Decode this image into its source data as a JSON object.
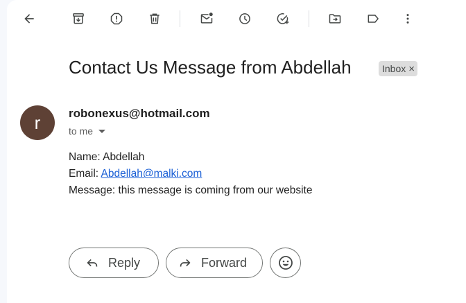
{
  "toolbar": {
    "icons": [
      "back-arrow-icon",
      "archive-icon",
      "report-spam-icon",
      "delete-icon",
      "mark-unread-icon",
      "snooze-icon",
      "add-to-tasks-icon",
      "move-to-icon",
      "label-icon",
      "more-options-icon"
    ]
  },
  "email": {
    "subject": "Contact Us Message from Abdellah",
    "label_chip": "Inbox",
    "chip_remove": "×",
    "avatar_letter": "r",
    "avatar_color": "#5e4135",
    "sender": "robonexus@hotmail.com",
    "recipient": "to me",
    "body": {
      "name_line": "Name: Abdellah",
      "email_label": "Email: ",
      "email_link": "Abdellah@malki.com",
      "message_line": "Message: this message is coming from our website"
    }
  },
  "actions": {
    "reply_label": "Reply",
    "forward_label": "Forward"
  }
}
